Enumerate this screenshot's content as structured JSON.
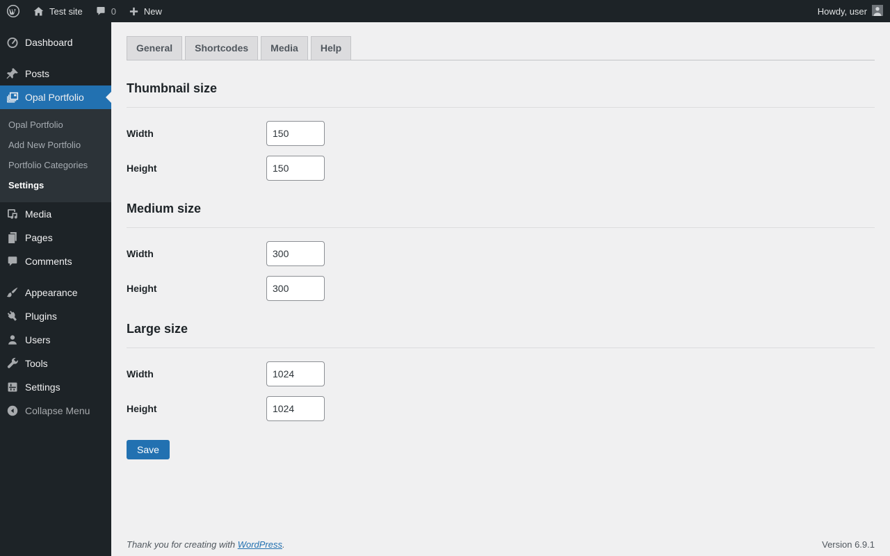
{
  "admin_bar": {
    "site_name": "Test site",
    "comment_count": "0",
    "new_label": "New",
    "howdy": "Howdy, user"
  },
  "sidebar": {
    "items": [
      {
        "label": "Dashboard"
      },
      {
        "label": "Posts"
      },
      {
        "label": "Opal Portfolio"
      },
      {
        "label": "Media"
      },
      {
        "label": "Pages"
      },
      {
        "label": "Comments"
      },
      {
        "label": "Appearance"
      },
      {
        "label": "Plugins"
      },
      {
        "label": "Users"
      },
      {
        "label": "Tools"
      },
      {
        "label": "Settings"
      }
    ],
    "submenu": {
      "items": [
        {
          "label": "Opal Portfolio"
        },
        {
          "label": "Add New Portfolio"
        },
        {
          "label": "Portfolio Categories"
        },
        {
          "label": "Settings"
        }
      ]
    },
    "collapse_label": "Collapse Menu"
  },
  "tabs": [
    {
      "label": "General"
    },
    {
      "label": "Shortcodes"
    },
    {
      "label": "Media"
    },
    {
      "label": "Help"
    }
  ],
  "sections": [
    {
      "title": "Thumbnail size",
      "fields": [
        {
          "label": "Width",
          "value": "150"
        },
        {
          "label": "Height",
          "value": "150"
        }
      ]
    },
    {
      "title": "Medium size",
      "fields": [
        {
          "label": "Width",
          "value": "300"
        },
        {
          "label": "Height",
          "value": "300"
        }
      ]
    },
    {
      "title": "Large size",
      "fields": [
        {
          "label": "Width",
          "value": "1024"
        },
        {
          "label": "Height",
          "value": "1024"
        }
      ]
    }
  ],
  "form": {
    "save_label": "Save"
  },
  "footer": {
    "thanks_text": "Thank you for creating with",
    "link_label": "WordPress",
    "period": ".",
    "version": "Version 6.9.1"
  },
  "colors": {
    "accent_blue": "#2271b1",
    "admin_bar_bg": "#1d2327",
    "submenu_bg": "#2c3338",
    "content_bg": "#f0f0f1"
  }
}
